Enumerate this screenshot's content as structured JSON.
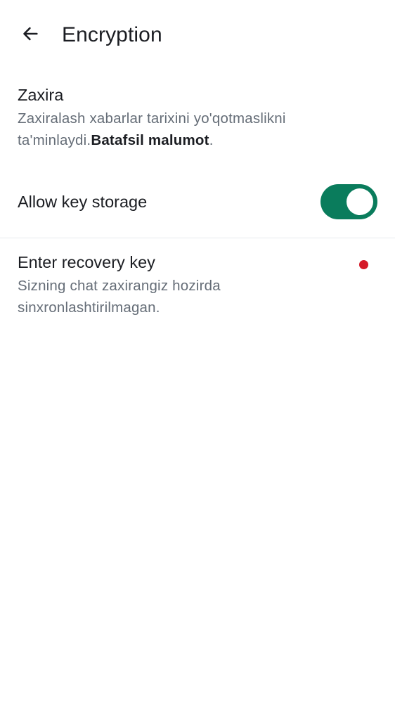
{
  "header": {
    "title": "Encryption",
    "back_icon": "arrow-left-icon"
  },
  "backup": {
    "heading": "Zaxira",
    "description": "Zaxiralash xabarlar tarixini yo'qotmaslikni ta'minlaydi.",
    "link_text": "Batafsil malumot",
    "trailing": "."
  },
  "key_storage": {
    "label": "Allow key storage",
    "enabled": true,
    "accent_color": "#0a7c5c"
  },
  "recovery": {
    "title": "Enter recovery key",
    "description": "Sizning chat zaxirangiz hozirda sinxronlashtirilmagan.",
    "status_color": "#d51928"
  }
}
